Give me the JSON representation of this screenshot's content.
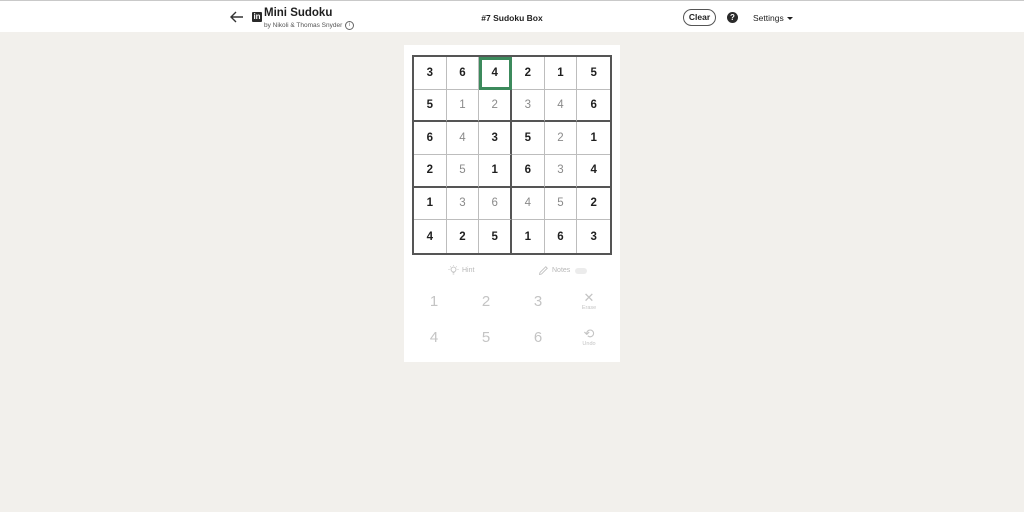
{
  "header": {
    "title": "Mini Sudoku",
    "byline": "by Nikoli & Thomas Snyder",
    "logo_text": "in",
    "info_glyph": "i",
    "puzzle_name": "#7 Sudoku Box",
    "clear_label": "Clear",
    "help_glyph": "?",
    "settings_label": "Settings"
  },
  "grid": {
    "selected": [
      0,
      2
    ],
    "rows": [
      [
        {
          "v": "3",
          "t": "given"
        },
        {
          "v": "6",
          "t": "given"
        },
        {
          "v": "4",
          "t": "given"
        },
        {
          "v": "2",
          "t": "given"
        },
        {
          "v": "1",
          "t": "given"
        },
        {
          "v": "5",
          "t": "given"
        }
      ],
      [
        {
          "v": "5",
          "t": "given"
        },
        {
          "v": "1",
          "t": "filled"
        },
        {
          "v": "2",
          "t": "filled"
        },
        {
          "v": "3",
          "t": "filled"
        },
        {
          "v": "4",
          "t": "filled"
        },
        {
          "v": "6",
          "t": "given"
        }
      ],
      [
        {
          "v": "6",
          "t": "given"
        },
        {
          "v": "4",
          "t": "filled"
        },
        {
          "v": "3",
          "t": "given"
        },
        {
          "v": "5",
          "t": "given"
        },
        {
          "v": "2",
          "t": "filled"
        },
        {
          "v": "1",
          "t": "given"
        }
      ],
      [
        {
          "v": "2",
          "t": "given"
        },
        {
          "v": "5",
          "t": "filled"
        },
        {
          "v": "1",
          "t": "given"
        },
        {
          "v": "6",
          "t": "given"
        },
        {
          "v": "3",
          "t": "filled"
        },
        {
          "v": "4",
          "t": "given"
        }
      ],
      [
        {
          "v": "1",
          "t": "given"
        },
        {
          "v": "3",
          "t": "filled"
        },
        {
          "v": "6",
          "t": "filled"
        },
        {
          "v": "4",
          "t": "filled"
        },
        {
          "v": "5",
          "t": "filled"
        },
        {
          "v": "2",
          "t": "given"
        }
      ],
      [
        {
          "v": "4",
          "t": "given"
        },
        {
          "v": "2",
          "t": "given"
        },
        {
          "v": "5",
          "t": "given"
        },
        {
          "v": "1",
          "t": "given"
        },
        {
          "v": "6",
          "t": "given"
        },
        {
          "v": "3",
          "t": "given"
        }
      ]
    ]
  },
  "tools": {
    "hint_label": "Hint",
    "notes_label": "Notes",
    "notes_state": "Off"
  },
  "keypad": {
    "numbers": [
      "1",
      "2",
      "3",
      "4",
      "5",
      "6"
    ],
    "erase_label": "Erase",
    "undo_label": "Undo"
  },
  "colors": {
    "selected_border": "#3c8a5c",
    "background": "#f2f0ec"
  }
}
